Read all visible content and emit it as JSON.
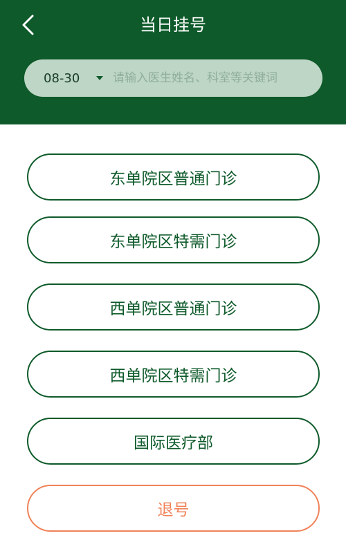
{
  "header": {
    "title": "当日挂号",
    "back_icon": "chevron-left-icon"
  },
  "search": {
    "date": "08-30",
    "dropdown_icon": "caret-down-icon",
    "placeholder": "请输入医生姓名、科室等关键词"
  },
  "departments": [
    {
      "label": "东单院区普通门诊"
    },
    {
      "label": "东单院区特需门诊"
    },
    {
      "label": "西单院区普通门诊"
    },
    {
      "label": "西单院区特需门诊"
    },
    {
      "label": "国际医疗部"
    }
  ],
  "cancel": {
    "label": "退号"
  },
  "colors": {
    "primary": "#0e5a2a",
    "cancel": "#f08258",
    "search_bg": "#bed6c6"
  }
}
